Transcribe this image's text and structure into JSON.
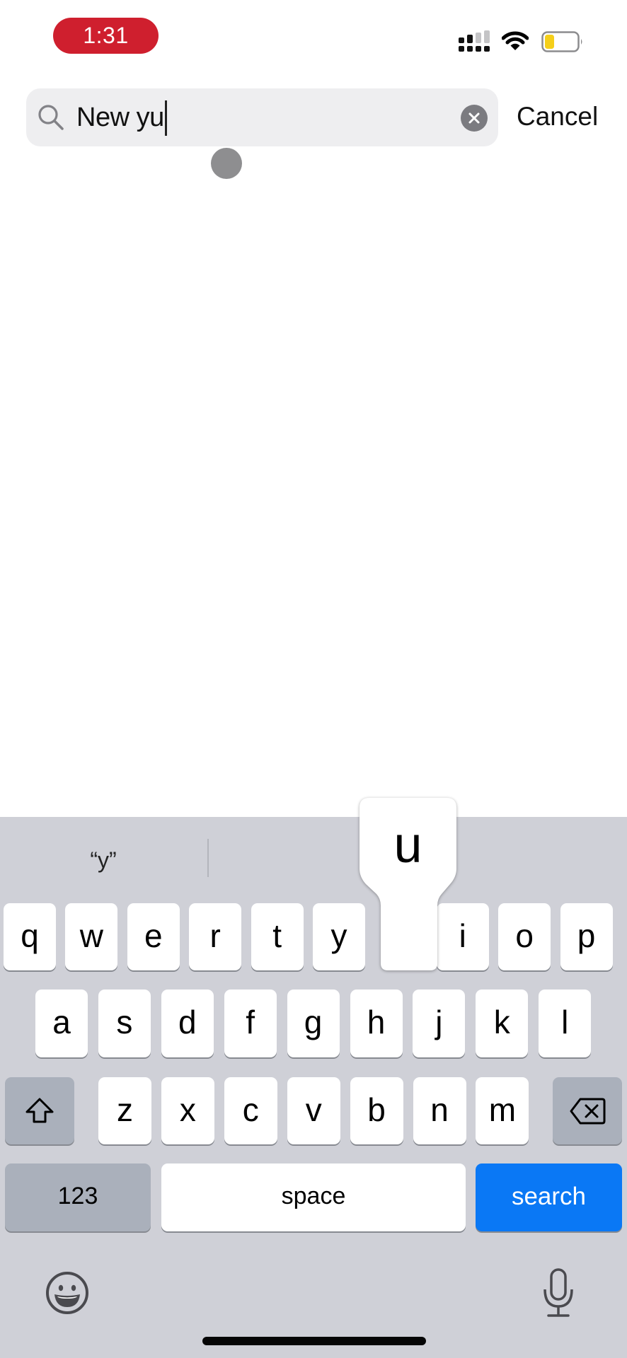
{
  "status_bar": {
    "time": "1:31",
    "time_pill_color": "#cf1f2e",
    "signal_bars_active": 2,
    "signal_bars_total": 4,
    "battery_level": 0.25,
    "battery_color": "#f5cf1a"
  },
  "search": {
    "value": "New yu",
    "cancel_label": "Cancel"
  },
  "keyboard": {
    "suggestion": "“y”",
    "popup_key": "u",
    "row1": [
      "q",
      "w",
      "e",
      "r",
      "t",
      "y",
      "u",
      "i",
      "o",
      "p"
    ],
    "row2": [
      "a",
      "s",
      "d",
      "f",
      "g",
      "h",
      "j",
      "k",
      "l"
    ],
    "row3": [
      "z",
      "x",
      "c",
      "v",
      "b",
      "n",
      "m"
    ],
    "numbers_label": "123",
    "space_label": "space",
    "search_label": "search",
    "accent_color": "#0a78f5"
  }
}
